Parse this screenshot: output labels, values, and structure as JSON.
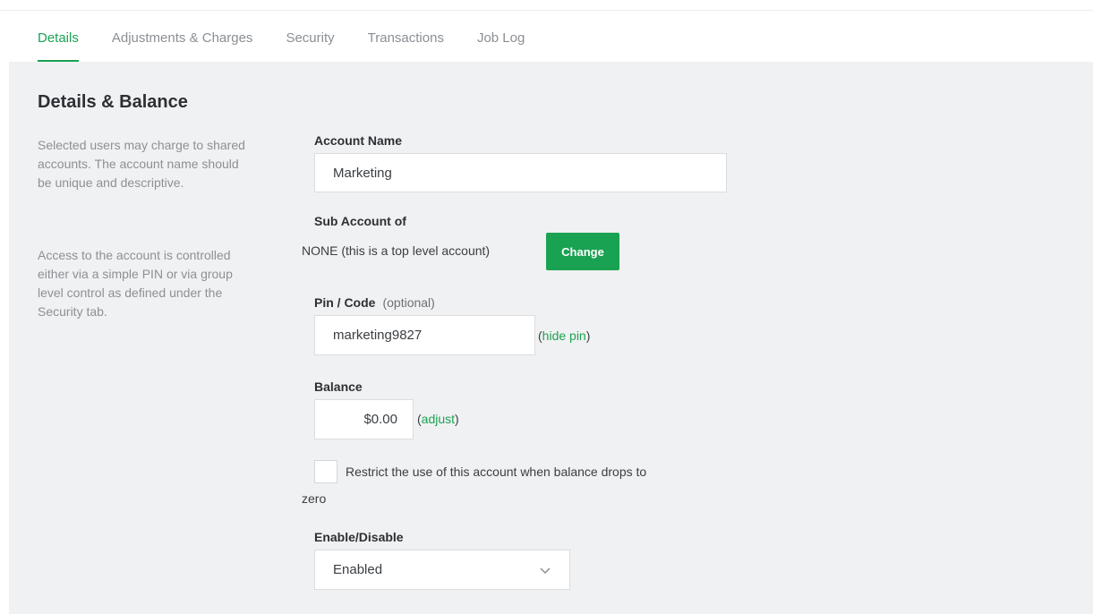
{
  "tabs": [
    {
      "label": "Details",
      "active": true
    },
    {
      "label": "Adjustments & Charges",
      "active": false
    },
    {
      "label": "Security",
      "active": false
    },
    {
      "label": "Transactions",
      "active": false
    },
    {
      "label": "Job Log",
      "active": false
    }
  ],
  "section": {
    "title": "Details & Balance",
    "description_1": "Selected users may charge to shared accounts. The account name should be unique and descriptive.",
    "description_2": "Access to the account is controlled either via a simple PIN or via group level control as defined under the Security tab."
  },
  "form": {
    "account_name": {
      "label": "Account Name",
      "value": "Marketing"
    },
    "sub_account": {
      "label": "Sub Account of",
      "value": "NONE (this is a top level account)",
      "change_label": "Change"
    },
    "pin": {
      "label": "Pin / Code",
      "optional_label": "(optional)",
      "value": "marketing9827",
      "paren_open": "(",
      "link_label": "hide pin",
      "paren_close": ")"
    },
    "balance": {
      "label": "Balance",
      "value": "$0.00",
      "paren_open": "(",
      "link_label": "adjust",
      "paren_close": ")"
    },
    "restrict": {
      "label": "Restrict the use of this account when balance drops to",
      "label_cont": "zero",
      "checked": false
    },
    "enable": {
      "label": "Enable/Disable",
      "selected": "Enabled"
    }
  },
  "colors": {
    "accent": "#1aa253",
    "panel_bg": "#f0f1f2",
    "muted_text": "#8c9196"
  },
  "icons": {
    "dropdown": "chevron-down-icon"
  }
}
